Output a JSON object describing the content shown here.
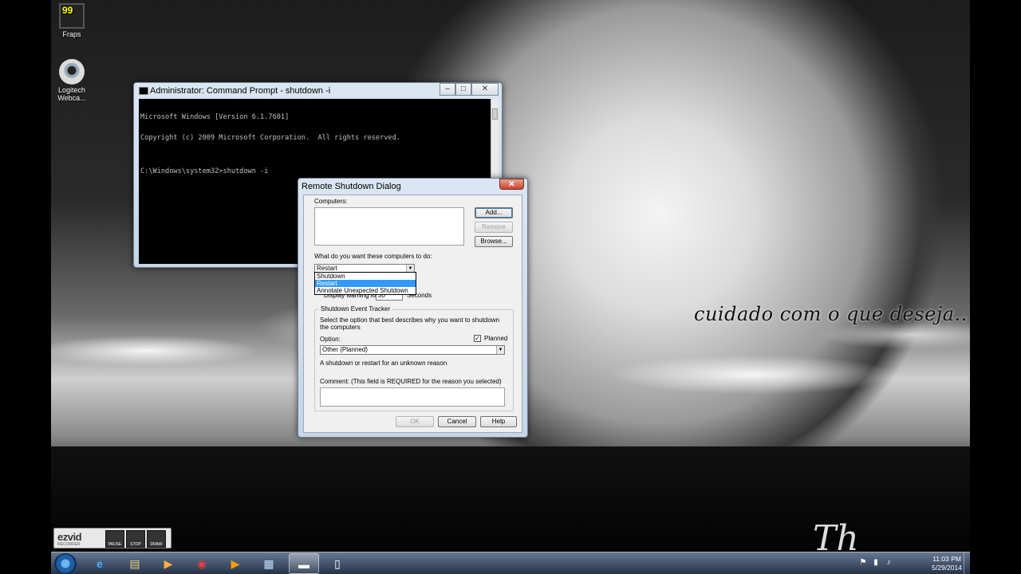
{
  "desktop": {
    "icons": [
      {
        "label": "Fraps",
        "badge": "99"
      },
      {
        "label": "Logitech Webca..."
      }
    ],
    "wallpaper_text": "cuidado com o que deseja..",
    "wallpaper_signature": "Th"
  },
  "cmd_window": {
    "title": "Administrator: Command Prompt - shutdown  -i",
    "lines": [
      "Microsoft Windows [Version 6.1.7601]",
      "Copyright (c) 2009 Microsoft Corporation.  All rights reserved.",
      "",
      "C:\\Windows\\system32>shutdown -i"
    ],
    "controls": {
      "minimize": "–",
      "maximize": "□",
      "close": "✕"
    }
  },
  "dialog": {
    "title": "Remote Shutdown Dialog",
    "close": "✕",
    "computers_label": "Computers:",
    "add_button": "Add...",
    "remove_button": "Remove",
    "browse_button": "Browse...",
    "action_label": "What do you want these computers to do:",
    "action_value": "Restart",
    "action_options": [
      "Shutdown",
      "Restart",
      "Annotate Unexpected Shutdown"
    ],
    "action_selected_index": 1,
    "warning_label": "Display warning for",
    "warning_value": "30",
    "warning_unit": "Seconds",
    "tracker": {
      "title": "Shutdown Event Tracker",
      "description": "Select the option that best describes why you want to shutdown the computers",
      "option_label": "Option:",
      "planned_label": "Planned",
      "planned_checked": true,
      "option_value": "Other (Planned)",
      "reason_text": "A shutdown or restart for an unknown reason",
      "comment_label": "Comment: (This field is REQUIRED for the reason you selected)"
    },
    "ok_button": "OK",
    "cancel_button": "Cancel",
    "help_button": "Help"
  },
  "ezvid": {
    "logo": "ezvid",
    "subtitle": "RECORDER",
    "pause": "PAUSE",
    "stop": "STOP",
    "draw": "DRAW"
  },
  "taskbar": {
    "items": [
      {
        "name": "internet-explorer",
        "glyph": "e"
      },
      {
        "name": "file-explorer",
        "glyph": "▤"
      },
      {
        "name": "media-player",
        "glyph": "▶"
      },
      {
        "name": "chrome",
        "glyph": "◉"
      },
      {
        "name": "media-player-orange",
        "glyph": "▶"
      },
      {
        "name": "app-window",
        "glyph": "▦"
      },
      {
        "name": "command-prompt",
        "glyph": "▬"
      },
      {
        "name": "document",
        "glyph": "▯"
      }
    ],
    "clock_time": "11:03 PM",
    "clock_date": "5/29/2014"
  },
  "colors": {
    "taskbar": "#2c3e58",
    "selection": "#3399ff",
    "close_button": "#c8452e"
  }
}
